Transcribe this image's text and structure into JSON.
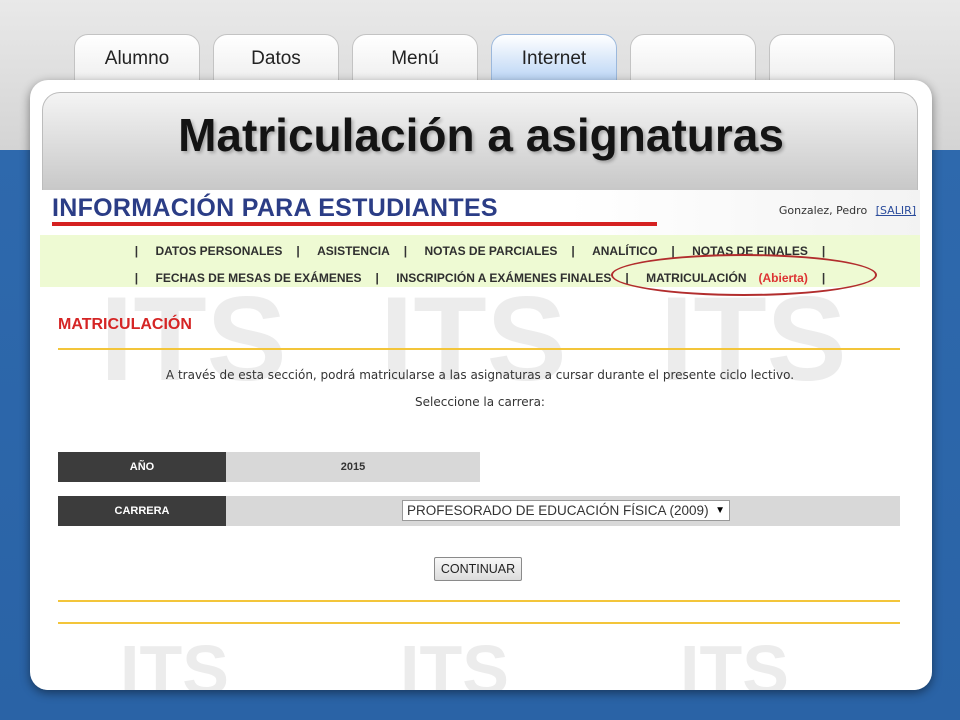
{
  "tabs": [
    {
      "label": "Alumno"
    },
    {
      "label": "Datos"
    },
    {
      "label": "Menú"
    },
    {
      "label": "Internet"
    },
    {
      "label": ""
    },
    {
      "label": ""
    }
  ],
  "slide_title": "Matriculación a asignaturas",
  "site": {
    "title": "INFORMACIÓN PARA ESTUDIANTES",
    "user_name": "Gonzalez, Pedro",
    "logout_label": "[SALIR]"
  },
  "nav": {
    "row1": [
      "DATOS PERSONALES",
      "ASISTENCIA",
      "NOTAS DE PARCIALES",
      "ANALÍTICO",
      "NOTAS DE FINALES"
    ],
    "row2": [
      "FECHAS DE MESAS DE EXÁMENES",
      "INSCRIPCIÓN A EXÁMENES FINALES",
      "MATRICULACIÓN"
    ],
    "open_label": "(Abierta)"
  },
  "section": {
    "title": "MATRICULACIÓN",
    "intro": "A través de esta sección, podrá matricularse a las asignaturas a cursar durante el presente ciclo lectivo.",
    "prompt": "Seleccione la carrera:",
    "year_label": "AÑO",
    "year_value": "2015",
    "career_label": "CARRERA",
    "career_selected": "PROFESORADO DE EDUCACIÓN FÍSICA (2009)",
    "continue_label": "CONTINUAR"
  },
  "watermark": {
    "text": "ITS"
  },
  "colors": {
    "accent_red": "#d52121",
    "nav_bg": "#eefad3",
    "divider_yellow": "#f3c53a",
    "title_blue": "#2b3d86",
    "background_blue": "#2e69ad"
  }
}
